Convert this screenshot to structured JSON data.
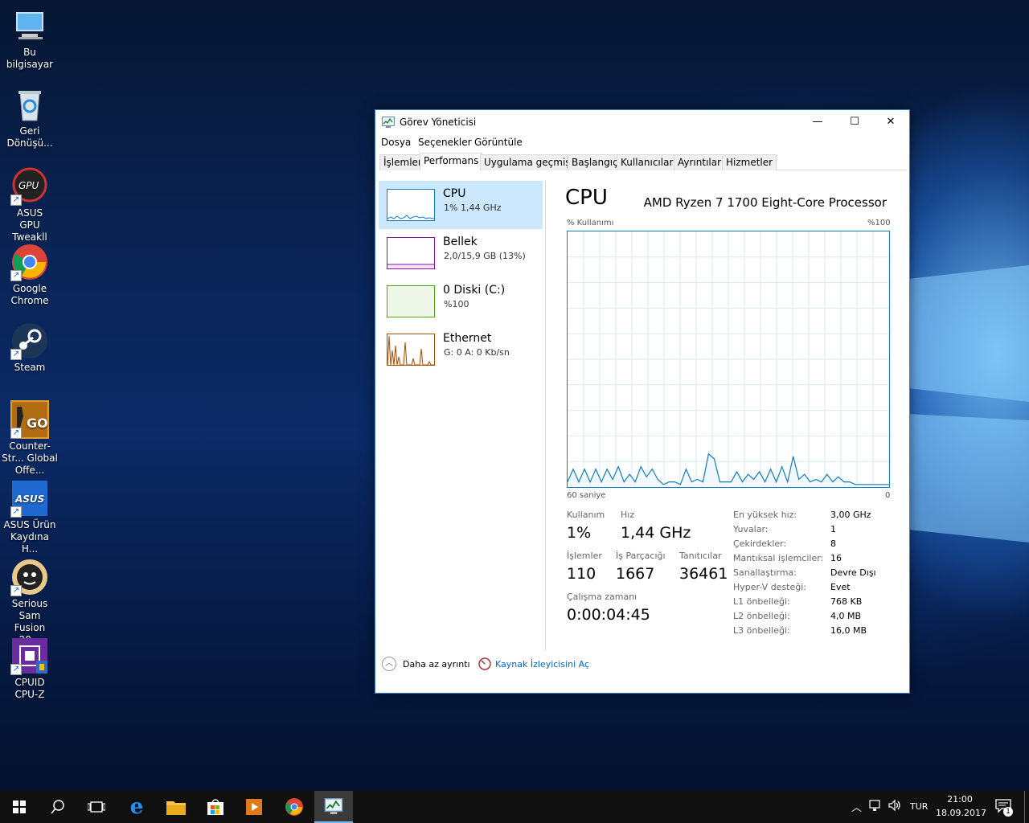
{
  "desktop": {
    "icons": [
      {
        "label": "Bu bilgisayar",
        "icon": "computer-icon"
      },
      {
        "label": "Geri Dönüşü...",
        "icon": "recycle-bin-icon"
      },
      {
        "label": "ASUS GPU Tweakll",
        "icon": "asus-gpu-tweak-icon"
      },
      {
        "label": "Google Chrome",
        "icon": "chrome-icon"
      },
      {
        "label": "Steam",
        "icon": "steam-icon"
      },
      {
        "label": "Counter-Str... Global Offe...",
        "icon": "csgo-icon"
      },
      {
        "label": "ASUS Ürün Kaydına H...",
        "icon": "asus-icon"
      },
      {
        "label": "Serious Sam Fusion 20...",
        "icon": "serious-sam-icon"
      },
      {
        "label": "CPUID CPU-Z",
        "icon": "cpuz-icon"
      }
    ]
  },
  "window": {
    "title": "Görev Yöneticisi",
    "controls": {
      "minimize": "—",
      "maximize": "☐",
      "close": "✕"
    },
    "menu": [
      "Dosya",
      "Seçenekler",
      "Görüntüle"
    ],
    "tabs": [
      "İşlemler",
      "Performans",
      "Uygulama geçmişi",
      "Başlangıç",
      "Kullanıcılar",
      "Ayrıntılar",
      "Hizmetler"
    ],
    "active_tab": "Performans"
  },
  "resources": [
    {
      "name": "CPU",
      "sub": "1%  1,44 GHz",
      "color": "#117dbb",
      "selected": true
    },
    {
      "name": "Bellek",
      "sub": "2,0/15,9 GB (13%)",
      "color": "#8b12ae",
      "selected": false
    },
    {
      "name": "0 Diski (C:)",
      "sub": "%100",
      "color": "#4da60c",
      "selected": false
    },
    {
      "name": "Ethernet",
      "sub": "G: 0 A: 0 Kb/sn",
      "color": "#a74f01",
      "selected": false
    }
  ],
  "cpu": {
    "title": "CPU",
    "model": "AMD Ryzen 7 1700 Eight-Core Processor",
    "y_label": "% Kullanımı",
    "y_max": "%100",
    "x_left": "60 saniye",
    "x_right": "0",
    "stats": {
      "usage_label": "Kullanım",
      "usage": "1%",
      "speed_label": "Hız",
      "speed": "1,44 GHz",
      "processes_label": "İşlemler",
      "processes": "110",
      "threads_label": "İş Parçacığı",
      "threads": "1667",
      "handles_label": "Tanıtıcılar",
      "handles": "36461",
      "uptime_label": "Çalışma zamanı",
      "uptime": "0:00:04:45"
    },
    "info": [
      {
        "k": "En yüksek hız:",
        "v": "3,00 GHz"
      },
      {
        "k": "Yuvalar:",
        "v": "1"
      },
      {
        "k": "Çekirdekler:",
        "v": "8"
      },
      {
        "k": "Mantıksal işlemciler:",
        "v": "16"
      },
      {
        "k": "Sanallaştırma:",
        "v": "Devre Dışı"
      },
      {
        "k": "Hyper-V desteği:",
        "v": "Evet"
      },
      {
        "k": "L1 önbelleği:",
        "v": "768 KB"
      },
      {
        "k": "L2 önbelleği:",
        "v": "4,0 MB"
      },
      {
        "k": "L3 önbelleği:",
        "v": "16,0 MB"
      }
    ]
  },
  "chart_data": {
    "type": "line",
    "title": "",
    "xlabel": "60 saniye",
    "ylabel": "% Kullanımı",
    "ylim": [
      0,
      100
    ],
    "xlim": [
      60,
      0
    ],
    "series": [
      {
        "values": [
          2,
          7,
          2,
          7,
          2,
          7,
          2,
          7,
          3,
          8,
          2,
          5,
          2,
          8,
          4,
          7,
          3,
          1,
          2,
          2,
          1,
          7,
          2,
          3,
          2,
          13,
          11,
          2,
          2,
          2,
          6,
          2,
          5,
          3,
          6,
          2,
          7,
          2,
          8,
          2,
          12,
          3,
          5,
          2,
          3,
          2,
          5,
          2,
          4,
          2,
          2,
          1,
          1,
          1,
          1,
          1,
          1,
          1
        ]
      }
    ]
  },
  "footer": {
    "less_details": "Daha az ayrıntı",
    "resource_monitor": "Kaynak İzleyicisini Aç"
  },
  "taskbar": {
    "items": [
      "windows-start-icon",
      "search-icon",
      "task-view-icon",
      "edge-icon",
      "file-explorer-icon",
      "store-icon",
      "media-player-icon",
      "chrome-icon",
      "task-manager-icon"
    ],
    "lang": "TUR",
    "time": "21:00",
    "date": "18.09.2017",
    "notification_count": "1"
  }
}
